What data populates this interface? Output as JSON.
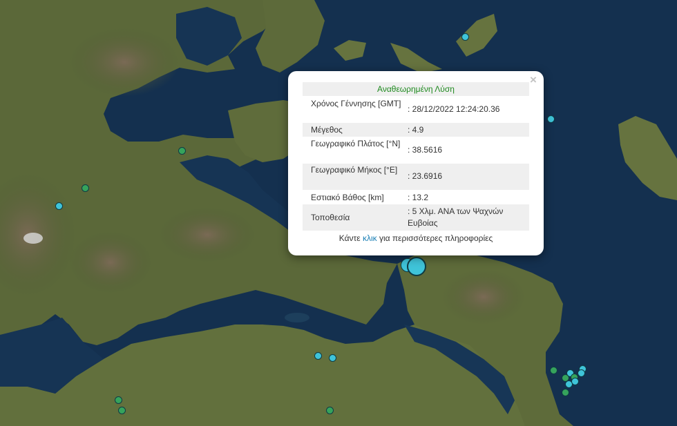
{
  "popup": {
    "title": "Αναθεωρημένη Λύση",
    "close_symbol": "×",
    "rows": [
      {
        "label": "Χρόνος Γέννησης [GMT]",
        "value": ": 28/12/2022 12:24:20.36"
      },
      {
        "label": "Μέγεθος",
        "value": ": 4.9"
      },
      {
        "label": "Γεωγραφικό Πλάτος [°N]",
        "value": ": 38.5616"
      },
      {
        "label": "Γεωγραφικό Μήκος [°E]",
        "value": ": 23.6916"
      },
      {
        "label": "Εστιακό Βάθος [km]",
        "value": ": 13.2"
      },
      {
        "label": "Τοποθεσία",
        "value": ": 5 Χλμ. ΑΝΑ των Ψαχνών Ευβοίας"
      }
    ],
    "footer_before": "Κάντε ",
    "footer_link": "κλικ",
    "footer_after": " για περισσότερες πληροφορίες"
  },
  "colors": {
    "sea": "#14304f",
    "land": "#5d6a3b",
    "marker_recent": "#3fc4d9",
    "marker_older": "#36a35c",
    "popup_title_text": "#1f8a1f",
    "link": "#1a7fb5"
  }
}
